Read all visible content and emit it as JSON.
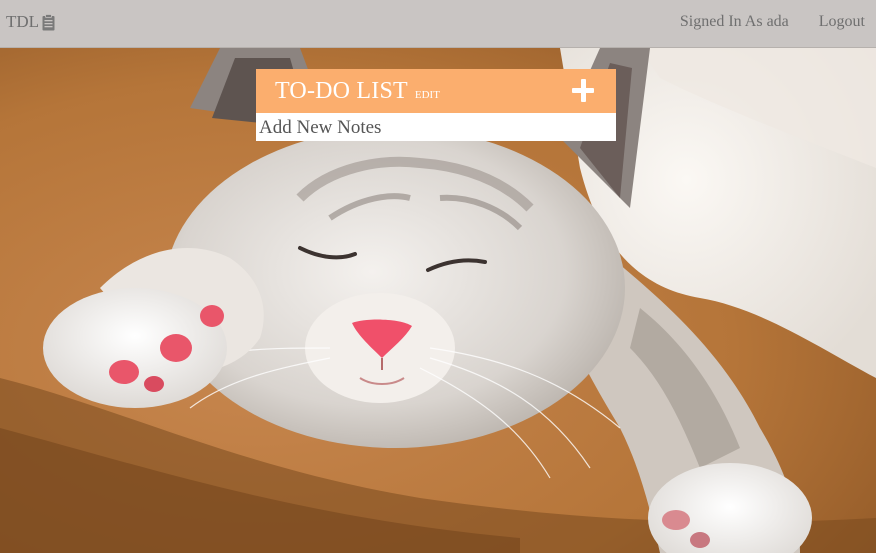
{
  "navbar": {
    "brand": "TDL",
    "brand_icon": "clipboard-icon",
    "signed_in_text": "Signed In As ada",
    "logout_label": "Logout"
  },
  "background": {
    "subject": "sleeping-kitten-photo"
  },
  "todo": {
    "title": "TO-DO LIST",
    "edit_label": "EDIT",
    "add_icon": "plus-icon",
    "input_placeholder": "Add New Notes",
    "header_color": "#fbae6e"
  }
}
